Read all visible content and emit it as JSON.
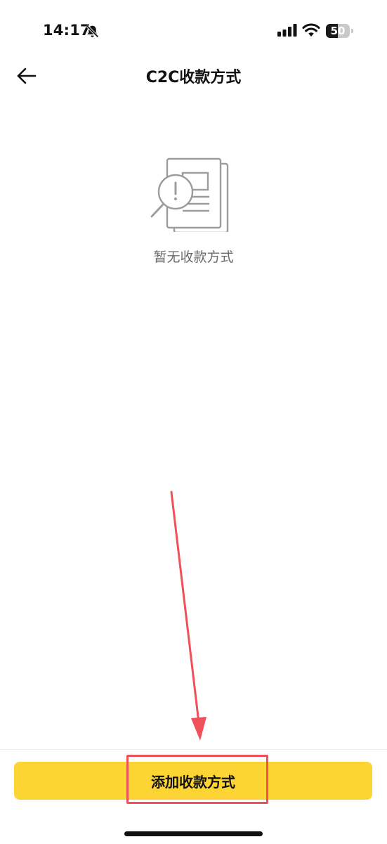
{
  "status_bar": {
    "time": "14:17",
    "battery_percent": 50,
    "battery_label": "50",
    "icons": [
      "bell-slash-icon",
      "signal-icon",
      "wifi-icon",
      "battery-icon"
    ]
  },
  "header": {
    "title": "C2C收款方式",
    "back_icon": "arrow-left-icon"
  },
  "empty_state": {
    "icon": "document-search-icon",
    "message": "暂无收款方式"
  },
  "footer": {
    "add_button_label": "添加收款方式"
  },
  "colors": {
    "accent": "#fcd535",
    "annotation": "#f0505a",
    "muted_text": "#6b6b6b"
  }
}
